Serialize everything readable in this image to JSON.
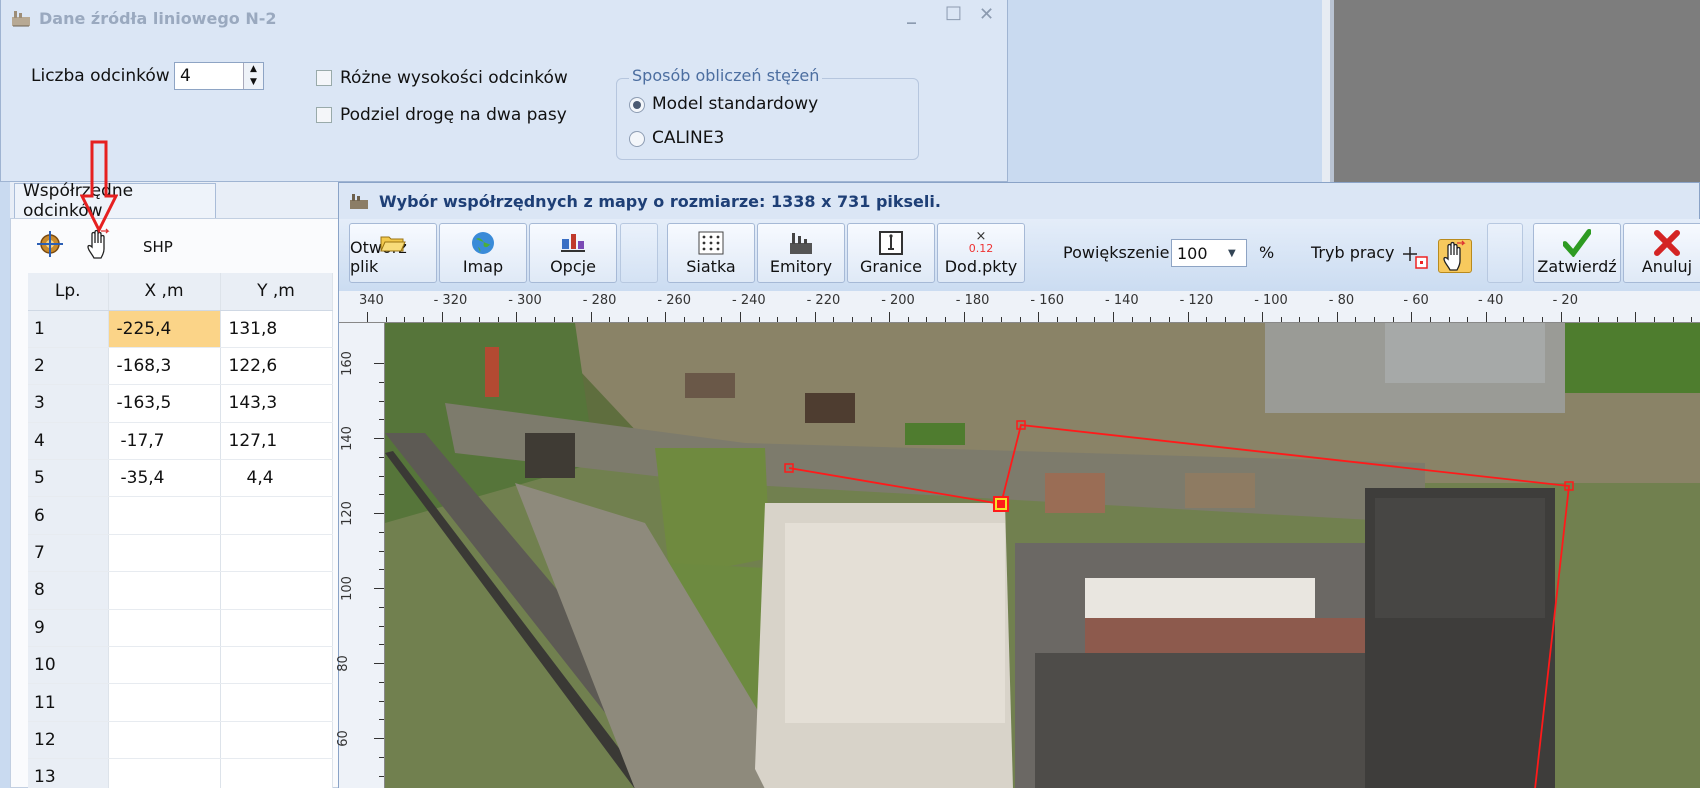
{
  "window1": {
    "title": "Dane źródła liniowego N-2",
    "controls": {
      "minimize": "_",
      "maximize": "□",
      "close": "✕"
    },
    "segment_count_label": "Liczba odcinków",
    "segment_count_value": "4",
    "checkbox_different_heights": "Różne wysokości odcinków",
    "checkbox_split_road": "Podziel drogę na dwa pasy",
    "calc_group_title": "Sposób obliczeń stężeń",
    "radio_standard": "Model standardowy",
    "radio_caline": "CALINE3"
  },
  "left_panel": {
    "tab_label": "Współrzędne odcinków",
    "shp_label": "SHP",
    "columns": [
      "Lp.",
      "X ,m",
      "Y ,m"
    ],
    "rows": [
      {
        "lp": "1",
        "x": "-225,4",
        "y": "131,8"
      },
      {
        "lp": "2",
        "x": "-168,3",
        "y": "122,6"
      },
      {
        "lp": "3",
        "x": "-163,5",
        "y": "143,3"
      },
      {
        "lp": "4",
        "x": "-17,7",
        "y": "127,1"
      },
      {
        "lp": "5",
        "x": "-35,4",
        "y": "4,4"
      },
      {
        "lp": "6",
        "x": "",
        "y": ""
      },
      {
        "lp": "7",
        "x": "",
        "y": ""
      },
      {
        "lp": "8",
        "x": "",
        "y": ""
      },
      {
        "lp": "9",
        "x": "",
        "y": ""
      },
      {
        "lp": "10",
        "x": "",
        "y": ""
      },
      {
        "lp": "11",
        "x": "",
        "y": ""
      },
      {
        "lp": "12",
        "x": "",
        "y": ""
      },
      {
        "lp": "13",
        "x": "",
        "y": ""
      }
    ]
  },
  "window2": {
    "title": "Wybór współrzędnych z mapy o rozmiarze: 1338 x 731 pikseli.",
    "toolbar": {
      "open_file": "Otwórz plik",
      "imap": "Imap",
      "options": "Opcje",
      "grid": "Siatka",
      "emitters": "Emitory",
      "boundaries": "Granice",
      "add_points": "Dod.pkty",
      "add_points_badge": "0.12",
      "zoom_label": "Powiększenie",
      "zoom_value": "100",
      "zoom_unit": "%",
      "mode_label": "Tryb pracy",
      "confirm": "Zatwierdź",
      "cancel": "Anuluj"
    },
    "ruler_x_labels": [
      "340",
      "- 320",
      "- 300",
      "- 280",
      "- 260",
      "- 240",
      "- 220",
      "- 200",
      "- 180",
      "- 160",
      "- 140",
      "- 120",
      "- 100",
      "- 80",
      "- 60",
      "- 40",
      "- 20"
    ],
    "ruler_y_labels": [
      "160",
      "140",
      "120",
      "100",
      "80",
      "60"
    ]
  },
  "colors": {
    "polyline": "#ff1a1a",
    "selected_cell": "#fbd488",
    "title_text": "#1e3f76"
  }
}
